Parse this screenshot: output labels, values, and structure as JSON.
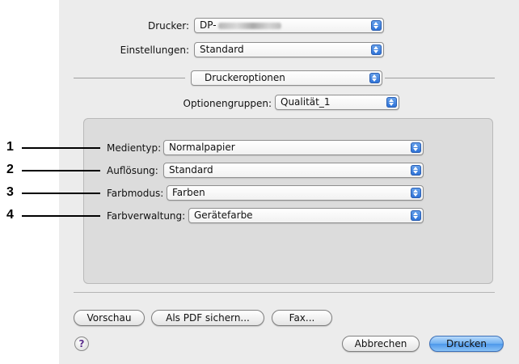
{
  "header": {
    "printer_label": "Drucker:",
    "printer_value": "DP-",
    "presets_label": "Einstellungen:",
    "presets_value": "Standard",
    "panel_value": "Druckeroptionen",
    "option_groups_label": "Optionengruppen:",
    "option_groups_value": "Qualität_1"
  },
  "options": [
    {
      "number": "1",
      "label": "Medientyp:",
      "value": "Normalpapier"
    },
    {
      "number": "2",
      "label": "Auflösung:",
      "value": "Standard"
    },
    {
      "number": "3",
      "label": "Farbmodus:",
      "value": "Farben"
    },
    {
      "number": "4",
      "label": "Farbverwaltung:",
      "value": "Gerätefarbe"
    }
  ],
  "footer": {
    "preview_button": "Vorschau",
    "save_pdf_button": "Als PDF sichern...",
    "fax_button": "Fax...",
    "help_glyph": "?",
    "cancel_button": "Abbrechen",
    "print_button": "Drucken"
  },
  "colors": {
    "accent": "#4d97ea",
    "dialog_background": "#ececec",
    "group_background": "#dcdcdc",
    "callout": "#000000"
  },
  "icons": [
    "popup-arrows-icon",
    "help-icon"
  ]
}
